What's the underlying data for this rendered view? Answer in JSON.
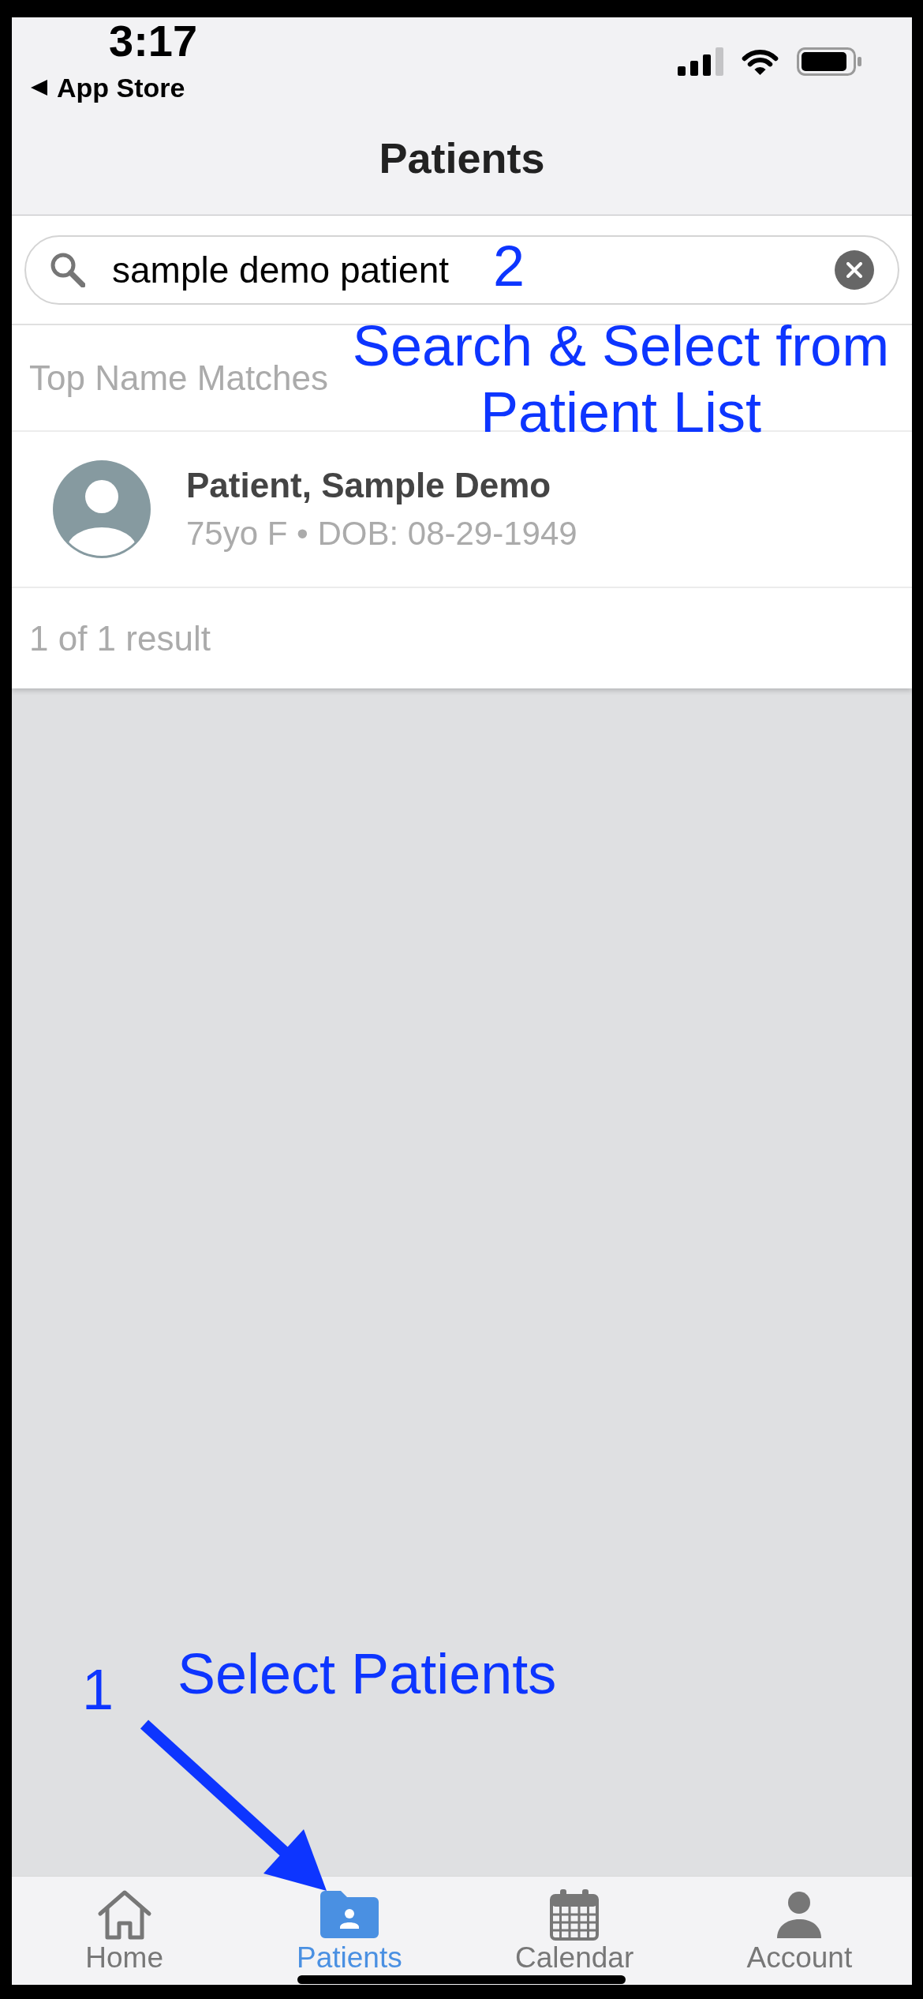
{
  "status_bar": {
    "time": "3:17",
    "back_label": "App Store"
  },
  "nav_bar": {
    "title": "Patients"
  },
  "search": {
    "value": "sample demo patient"
  },
  "results": {
    "section_title": "Top Name Matches",
    "patients": [
      {
        "name": "Patient, Sample Demo",
        "details": "75yo F • DOB: 08-29-1949"
      }
    ],
    "count": "1 of 1 result"
  },
  "tab_bar": {
    "tabs": [
      {
        "label": "Home",
        "selected": false
      },
      {
        "label": "Patients",
        "selected": true
      },
      {
        "label": "Calendar",
        "selected": false
      },
      {
        "label": "Account",
        "selected": false
      }
    ]
  },
  "annotations": [
    {
      "number": "2",
      "caption": "Search & Select from Patient List"
    },
    {
      "number": "1",
      "caption": "Select Patients"
    }
  ]
}
